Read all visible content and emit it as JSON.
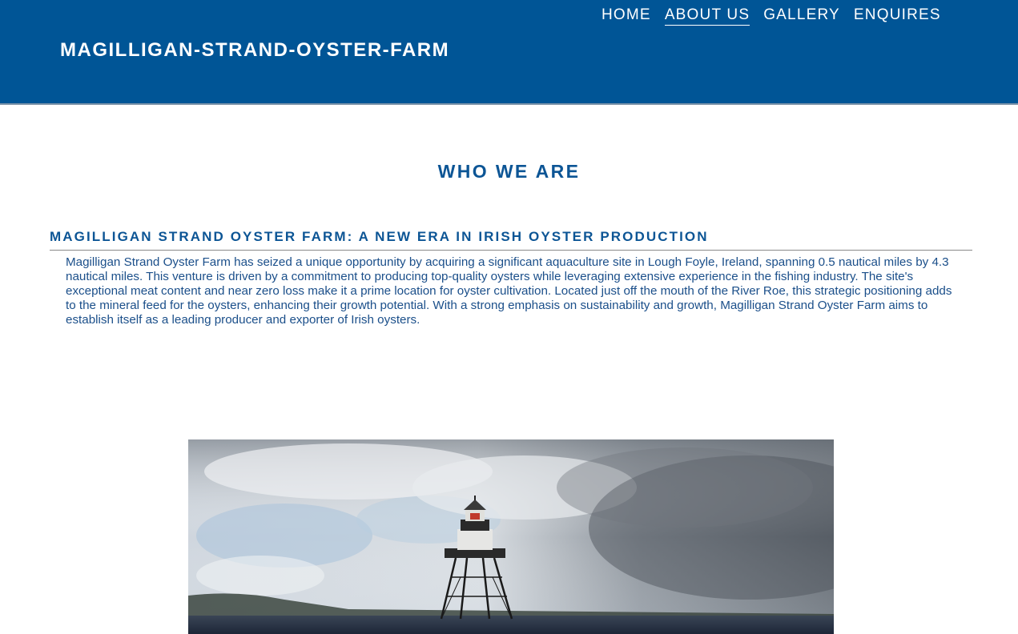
{
  "header": {
    "site_title": "MAGILLIGAN-STRAND-OYSTER-FARM",
    "nav": [
      {
        "label": "HOME"
      },
      {
        "label": "ABOUT US"
      },
      {
        "label": "GALLERY"
      },
      {
        "label": "ENQUIRES"
      }
    ],
    "active_nav": "ABOUT US",
    "background_color": "#005596"
  },
  "main": {
    "section_heading": "WHO WE ARE",
    "article_title": "MAGILLIGAN STRAND OYSTER FARM: A NEW ERA IN IRISH OYSTER PRODUCTION",
    "article_body": "Magilligan Strand Oyster Farm has seized a unique opportunity by acquiring a significant aquaculture site in Lough Foyle, Ireland, spanning 0.5 nautical miles by 4.3 nautical miles. This venture is driven by a commitment to producing top-quality oysters while leveraging extensive experience in the fishing industry. The site's exceptional meat content and near zero loss make it a prime location for oyster cultivation. Located just off the mouth of the River Roe, this strategic positioning adds to the mineral feed for the oysters, enhancing their growth potential. With a strong emphasis on sustainability and growth, Magilligan Strand Oyster Farm aims to establish itself as a leading producer and exporter of Irish oysters.",
    "text_color": "#0c5595"
  }
}
